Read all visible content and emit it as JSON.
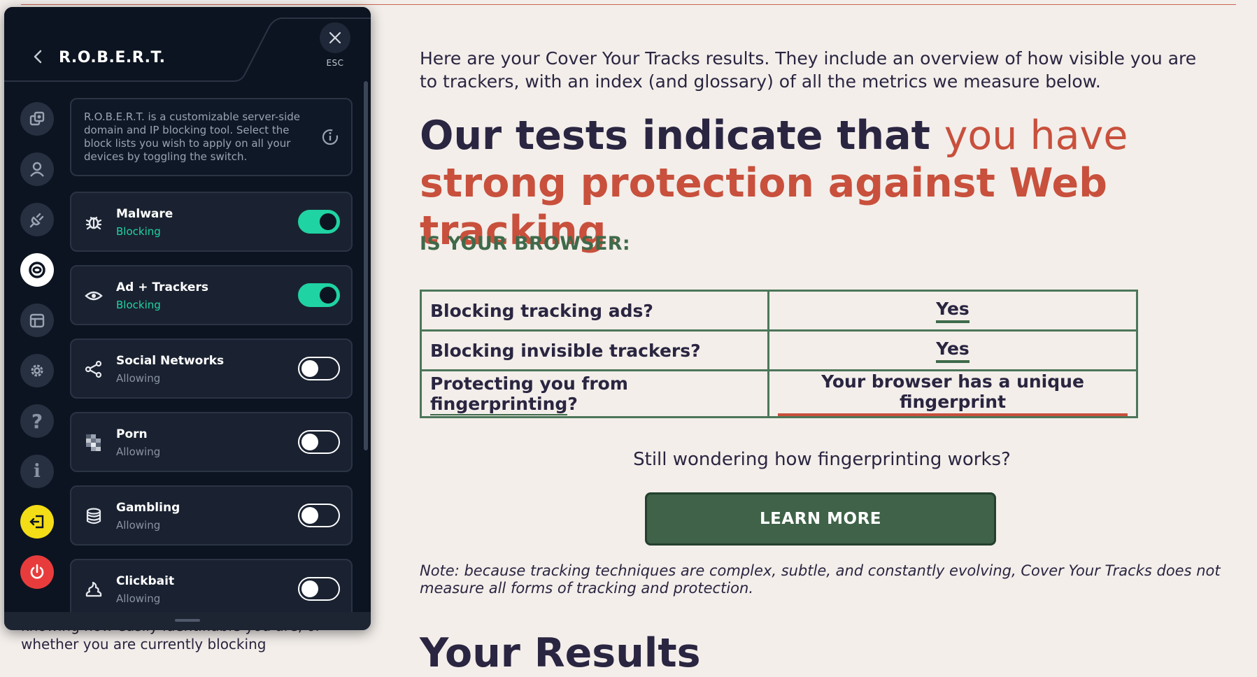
{
  "page": {
    "intro": "Here are your Cover Your Tracks results. They include an overview of how visible you are to trackers, with an index (and glossary) of all the metrics we measure below.",
    "headline": {
      "part1": "Our tests indicate that ",
      "part2": "you have ",
      "part3": "strong protection against Web tracking",
      "part4": "."
    },
    "subhead": "IS YOUR BROWSER:",
    "results_table": [
      {
        "question": "Blocking tracking ads?",
        "answer": "Yes"
      },
      {
        "question": "Blocking invisible trackers?",
        "answer": "Yes"
      },
      {
        "question_prefix": "Protecting you from ",
        "question_link": "fingerprinting",
        "question_suffix": "?",
        "answer": "Your browser has a unique fingerprint"
      }
    ],
    "wonder": "Still wondering how fingerprinting works?",
    "learn_more": "LEARN MORE",
    "note": "Note: because tracking techniques are complex, subtle, and constantly evolving, Cover Your Tracks does not measure all forms of tracking and protection.",
    "results_heading": "Your Results",
    "behind_text": "knowing how easily identifiable you are, or whether you are currently blocking"
  },
  "panel": {
    "title": "R.O.B.E.R.T.",
    "esc_label": "ESC",
    "description": "R.O.B.E.R.T. is a customizable server-side domain and IP blocking tool. Select the block lists you wish to apply on all your devices by toggling the switch.",
    "sidebar_icons": [
      "copy-icon",
      "user-icon",
      "plug-icon",
      "robert-icon",
      "box-icon",
      "gear-icon",
      "help-icon",
      "info-icon",
      "exit-icon",
      "power-icon"
    ],
    "categories": [
      {
        "name": "Malware",
        "status": "Blocking",
        "enabled": true,
        "icon": "bug-icon"
      },
      {
        "name": "Ad + Trackers",
        "status": "Blocking",
        "enabled": true,
        "icon": "eye-icon"
      },
      {
        "name": "Social Networks",
        "status": "Allowing",
        "enabled": false,
        "icon": "share-icon"
      },
      {
        "name": "Porn",
        "status": "Allowing",
        "enabled": false,
        "icon": "pixelated-icon"
      },
      {
        "name": "Gambling",
        "status": "Allowing",
        "enabled": false,
        "icon": "coins-icon"
      },
      {
        "name": "Clickbait",
        "status": "Allowing",
        "enabled": false,
        "icon": "poop-icon"
      }
    ],
    "colors": {
      "panel_bg": "#0c1421",
      "blocking": "#20d3a3",
      "accent_yellow": "#f3dd16",
      "power_red": "#e83c3c"
    }
  }
}
